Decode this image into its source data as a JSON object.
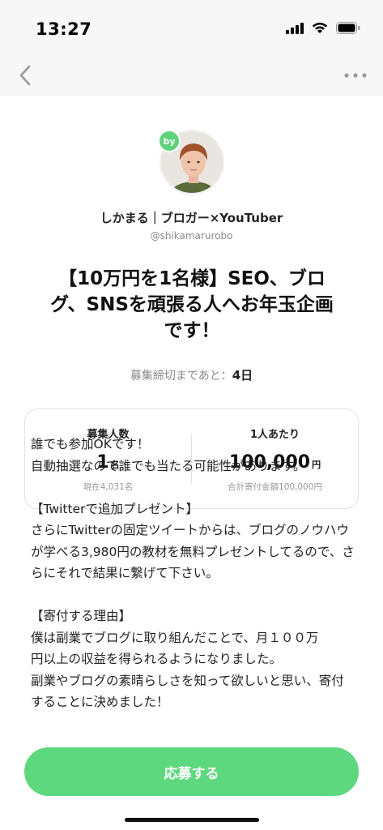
{
  "status_bar": {
    "time": "13:27"
  },
  "author": {
    "badge": "by",
    "name": "しかまる｜ブロガー×YouTuber",
    "handle": "@shikamarurobo"
  },
  "title": "【10万円を1名様】SEO、ブログ、SNSを頑張る人へお年玉企画です！",
  "deadline": {
    "label": "募集締切まであと：",
    "value": "4日"
  },
  "stats": {
    "recruit": {
      "label": "募集人数",
      "value": "1",
      "unit": "名",
      "sub": "現在4,031名"
    },
    "per_person": {
      "label": "1人あたり",
      "value": "100,000",
      "unit": "円",
      "sub": "合計寄付金額100,000円"
    }
  },
  "body": "誰でも参加OKです！\n自動抽選なので誰でも当たる可能性があります。\n\n【Twitterで追加プレゼント】\nさらにTwitterの固定ツイートからは、ブログのノウハウが学べる3,980円の教材を無料プレゼントしてるので、さらにそれで結果に繋げて下さい。\n\n【寄付する理由】\n僕は副業でブログに取り組んだことで、月１００万\n円以上の収益を得られるようになりました。\n副業やブログの素晴らしさを知って欲しいと思い、寄付することに決めました！",
  "apply_button": "応募する",
  "colors": {
    "accent": "#5ed87e",
    "badge": "#5fd27c"
  },
  "icons": [
    "back-chevron-icon",
    "more-dots-icon",
    "signal-icon",
    "wifi-icon",
    "battery-icon"
  ]
}
